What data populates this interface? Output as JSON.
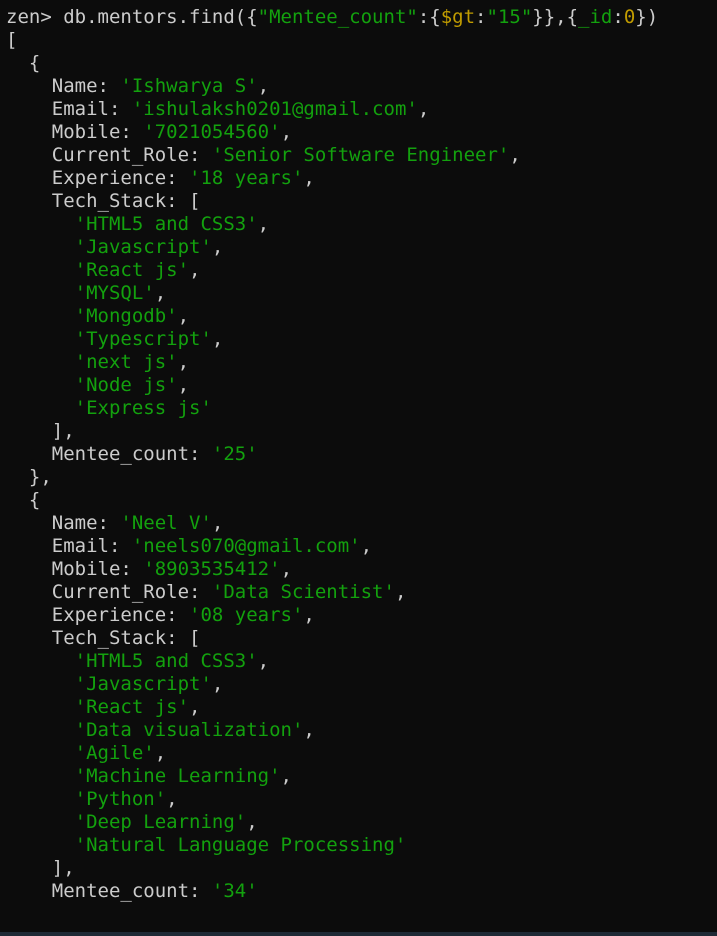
{
  "terminal": {
    "background": "#0c0c0c",
    "colors": {
      "default": "#cccccc",
      "string": "#13a10e",
      "operator": "#c19c00",
      "number": "#c19c00"
    },
    "lines": [
      [
        {
          "t": "zen> db.mentors.find({",
          "c": "default"
        },
        {
          "t": "\"Mentee_count\"",
          "c": "string"
        },
        {
          "t": ":{",
          "c": "default"
        },
        {
          "t": "$gt",
          "c": "operator"
        },
        {
          "t": ":",
          "c": "default"
        },
        {
          "t": "\"15\"",
          "c": "string"
        },
        {
          "t": "}},{",
          "c": "default"
        },
        {
          "t": "_id",
          "c": "string"
        },
        {
          "t": ":",
          "c": "default"
        },
        {
          "t": "0",
          "c": "number"
        },
        {
          "t": "})",
          "c": "default"
        }
      ],
      [
        {
          "t": "[",
          "c": "default"
        }
      ],
      [
        {
          "t": "  {",
          "c": "default"
        }
      ],
      [
        {
          "t": "    Name: ",
          "c": "default"
        },
        {
          "t": "'Ishwarya S'",
          "c": "string"
        },
        {
          "t": ",",
          "c": "default"
        }
      ],
      [
        {
          "t": "    Email: ",
          "c": "default"
        },
        {
          "t": "'ishulaksh0201@gmail.com'",
          "c": "string"
        },
        {
          "t": ",",
          "c": "default"
        }
      ],
      [
        {
          "t": "    Mobile: ",
          "c": "default"
        },
        {
          "t": "'7021054560'",
          "c": "string"
        },
        {
          "t": ",",
          "c": "default"
        }
      ],
      [
        {
          "t": "    Current_Role: ",
          "c": "default"
        },
        {
          "t": "'Senior Software Engineer'",
          "c": "string"
        },
        {
          "t": ",",
          "c": "default"
        }
      ],
      [
        {
          "t": "    Experience: ",
          "c": "default"
        },
        {
          "t": "'18 years'",
          "c": "string"
        },
        {
          "t": ",",
          "c": "default"
        }
      ],
      [
        {
          "t": "    Tech_Stack: [",
          "c": "default"
        }
      ],
      [
        {
          "t": "      ",
          "c": "default"
        },
        {
          "t": "'HTML5 and CSS3'",
          "c": "string"
        },
        {
          "t": ",",
          "c": "default"
        }
      ],
      [
        {
          "t": "      ",
          "c": "default"
        },
        {
          "t": "'Javascript'",
          "c": "string"
        },
        {
          "t": ",",
          "c": "default"
        }
      ],
      [
        {
          "t": "      ",
          "c": "default"
        },
        {
          "t": "'React js'",
          "c": "string"
        },
        {
          "t": ",",
          "c": "default"
        }
      ],
      [
        {
          "t": "      ",
          "c": "default"
        },
        {
          "t": "'MYSQL'",
          "c": "string"
        },
        {
          "t": ",",
          "c": "default"
        }
      ],
      [
        {
          "t": "      ",
          "c": "default"
        },
        {
          "t": "'Mongodb'",
          "c": "string"
        },
        {
          "t": ",",
          "c": "default"
        }
      ],
      [
        {
          "t": "      ",
          "c": "default"
        },
        {
          "t": "'Typescript'",
          "c": "string"
        },
        {
          "t": ",",
          "c": "default"
        }
      ],
      [
        {
          "t": "      ",
          "c": "default"
        },
        {
          "t": "'next js'",
          "c": "string"
        },
        {
          "t": ",",
          "c": "default"
        }
      ],
      [
        {
          "t": "      ",
          "c": "default"
        },
        {
          "t": "'Node js'",
          "c": "string"
        },
        {
          "t": ",",
          "c": "default"
        }
      ],
      [
        {
          "t": "      ",
          "c": "default"
        },
        {
          "t": "'Express js'",
          "c": "string"
        }
      ],
      [
        {
          "t": "    ],",
          "c": "default"
        }
      ],
      [
        {
          "t": "    Mentee_count: ",
          "c": "default"
        },
        {
          "t": "'25'",
          "c": "string"
        }
      ],
      [
        {
          "t": "  },",
          "c": "default"
        }
      ],
      [
        {
          "t": "  {",
          "c": "default"
        }
      ],
      [
        {
          "t": "    Name: ",
          "c": "default"
        },
        {
          "t": "'Neel V'",
          "c": "string"
        },
        {
          "t": ",",
          "c": "default"
        }
      ],
      [
        {
          "t": "    Email: ",
          "c": "default"
        },
        {
          "t": "'neels070@gmail.com'",
          "c": "string"
        },
        {
          "t": ",",
          "c": "default"
        }
      ],
      [
        {
          "t": "    Mobile: ",
          "c": "default"
        },
        {
          "t": "'8903535412'",
          "c": "string"
        },
        {
          "t": ",",
          "c": "default"
        }
      ],
      [
        {
          "t": "    Current_Role: ",
          "c": "default"
        },
        {
          "t": "'Data Scientist'",
          "c": "string"
        },
        {
          "t": ",",
          "c": "default"
        }
      ],
      [
        {
          "t": "    Experience: ",
          "c": "default"
        },
        {
          "t": "'08 years'",
          "c": "string"
        },
        {
          "t": ",",
          "c": "default"
        }
      ],
      [
        {
          "t": "    Tech_Stack: [",
          "c": "default"
        }
      ],
      [
        {
          "t": "      ",
          "c": "default"
        },
        {
          "t": "'HTML5 and CSS3'",
          "c": "string"
        },
        {
          "t": ",",
          "c": "default"
        }
      ],
      [
        {
          "t": "      ",
          "c": "default"
        },
        {
          "t": "'Javascript'",
          "c": "string"
        },
        {
          "t": ",",
          "c": "default"
        }
      ],
      [
        {
          "t": "      ",
          "c": "default"
        },
        {
          "t": "'React js'",
          "c": "string"
        },
        {
          "t": ",",
          "c": "default"
        }
      ],
      [
        {
          "t": "      ",
          "c": "default"
        },
        {
          "t": "'Data visualization'",
          "c": "string"
        },
        {
          "t": ",",
          "c": "default"
        }
      ],
      [
        {
          "t": "      ",
          "c": "default"
        },
        {
          "t": "'Agile'",
          "c": "string"
        },
        {
          "t": ",",
          "c": "default"
        }
      ],
      [
        {
          "t": "      ",
          "c": "default"
        },
        {
          "t": "'Machine Learning'",
          "c": "string"
        },
        {
          "t": ",",
          "c": "default"
        }
      ],
      [
        {
          "t": "      ",
          "c": "default"
        },
        {
          "t": "'Python'",
          "c": "string"
        },
        {
          "t": ",",
          "c": "default"
        }
      ],
      [
        {
          "t": "      ",
          "c": "default"
        },
        {
          "t": "'Deep Learning'",
          "c": "string"
        },
        {
          "t": ",",
          "c": "default"
        }
      ],
      [
        {
          "t": "      ",
          "c": "default"
        },
        {
          "t": "'Natural Language Processing'",
          "c": "string"
        }
      ],
      [
        {
          "t": "    ],",
          "c": "default"
        }
      ],
      [
        {
          "t": "    Mentee_count: ",
          "c": "default"
        },
        {
          "t": "'34'",
          "c": "string"
        }
      ]
    ]
  }
}
